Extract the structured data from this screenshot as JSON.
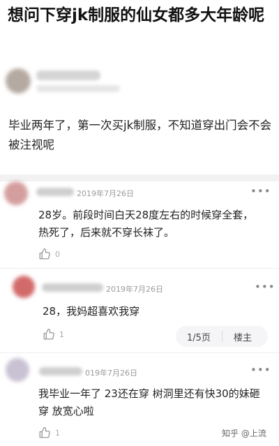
{
  "post": {
    "title": "想问下穿jk制服的仙女都多大年龄呢",
    "body": "毕业两年了，第一次买jk制服，不知道穿出门会不会被注视呢"
  },
  "comments": [
    {
      "date": "2019年7月26日",
      "text": "28岁。前段时间白天28度左右的时候穿全套，热死了，后来就不穿长袜了。",
      "likes": "0",
      "more": "•••"
    },
    {
      "date": "2019年7月26日",
      "text": "28，我妈超喜欢我穿",
      "likes": "1",
      "more": "•••",
      "pager": "1/5页",
      "floor_owner": "楼主"
    },
    {
      "date": "019年7月26日",
      "text": "我毕业一年了 23还在穿 树洞里还有快30的妹砸穿 放宽心啦",
      "likes": "1",
      "more": "•••"
    }
  ],
  "watermark": "知乎 @上流",
  "colors": {
    "divider": "#f2f2f2",
    "muted": "#9a9a9a",
    "pill_bg": "#f5f5f7"
  }
}
